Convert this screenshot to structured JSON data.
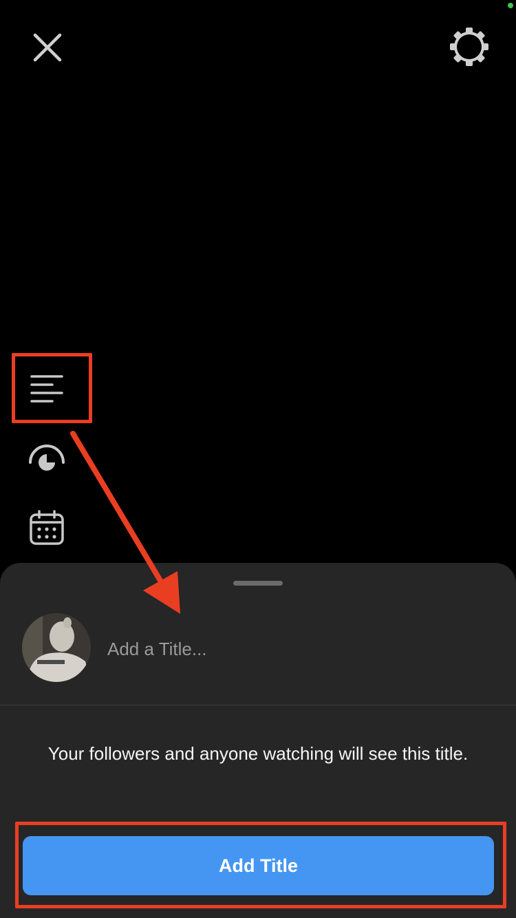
{
  "colors": {
    "background": "#000000",
    "sheet": "#262626",
    "accent": "#4596f2",
    "annotation": "#ea3e23",
    "status_indicator": "#3ec253"
  },
  "top_bar": {
    "close_icon": "close-icon",
    "settings_icon": "gear-icon"
  },
  "side_tools": [
    {
      "name": "title-tool",
      "icon": "text-lines-icon"
    },
    {
      "name": "audience-tool",
      "icon": "audience-icon"
    },
    {
      "name": "schedule-tool",
      "icon": "calendar-icon"
    }
  ],
  "sheet": {
    "title_placeholder": "Add a Title...",
    "title_value": "",
    "helper_text": "Your followers and anyone watching will see this title.",
    "add_title_label": "Add Title"
  }
}
